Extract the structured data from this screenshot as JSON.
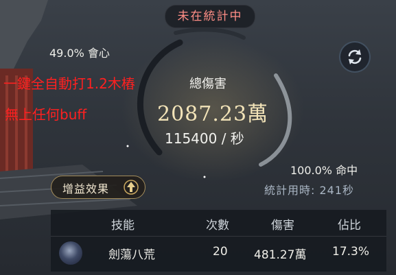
{
  "status": {
    "text": "未在統計中"
  },
  "stats": {
    "crit": "49.0% 會心",
    "hit": "100.0% 命中",
    "timer": "統計用時: 241秒"
  },
  "overlay": {
    "line1": "一鍵全自動打1.2木樁",
    "line2": "無上任何buff"
  },
  "damage": {
    "total_label": "總傷害",
    "total_value": "2087.23萬",
    "dps": "115400 / 秒"
  },
  "buttons": {
    "refresh_icon": "refresh-icon",
    "buff_label": "增益效果"
  },
  "table": {
    "headers": [
      "技能",
      "次數",
      "傷害",
      "佔比"
    ],
    "rows": [
      {
        "skill": "劍蕩八荒",
        "count": "20",
        "damage": "481.27萬",
        "share": "17.3%"
      }
    ]
  },
  "colors": {
    "status_text": "#ff8e86",
    "overlay_text": "#ff2020",
    "total_value": "#f2e3b8",
    "timer_text": "#aab6c4"
  }
}
